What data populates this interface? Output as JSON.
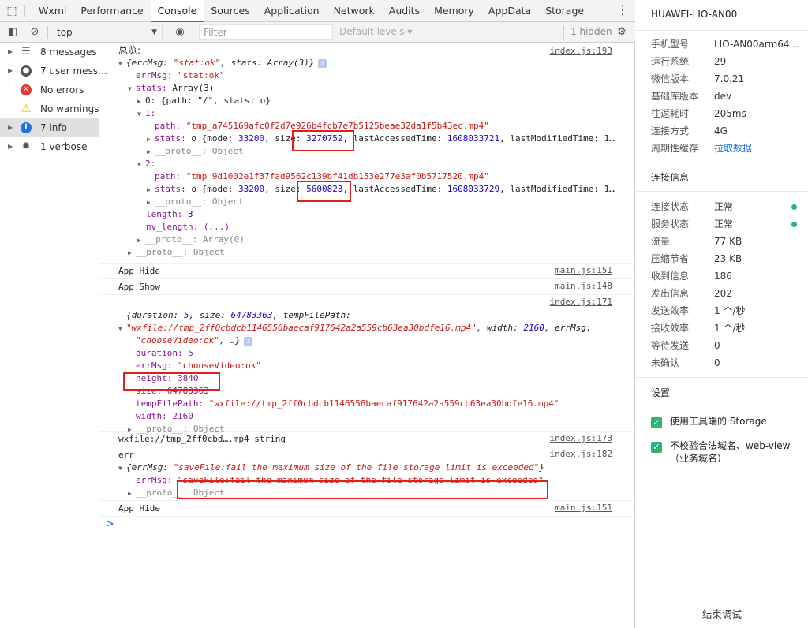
{
  "tabs": [
    "Wxml",
    "Performance",
    "Console",
    "Sources",
    "Application",
    "Network",
    "Audits",
    "Memory",
    "AppData",
    "Storage"
  ],
  "active_tab": "Console",
  "toolbar": {
    "context": "top",
    "filter_placeholder": "Filter",
    "levels": "Default levels ▾",
    "hidden": "1 hidden"
  },
  "sidebar": {
    "items": [
      {
        "label": "8 messages",
        "icon": "list-icon"
      },
      {
        "label": "7 user mess…",
        "icon": "user-icon"
      },
      {
        "label": "No errors",
        "icon": "error-icon"
      },
      {
        "label": "No warnings",
        "icon": "warning-icon"
      },
      {
        "label": "7 info",
        "icon": "info-icon"
      },
      {
        "label": "1 verbose",
        "icon": "bug-icon"
      }
    ]
  },
  "console": {
    "m1": {
      "label": "总览:",
      "src": "index.js:193",
      "summary_a": "{errMsg: ",
      "summary_b": "\"stat:ok\"",
      "summary_c": ", stats: Array(3)}",
      "errMsg_key": "errMsg: ",
      "errMsg_val": "\"stat:ok\"",
      "stats_key": "stats: ",
      "stats_val": "Array(3)",
      "item0": "0: {path: \"/\", stats: o}",
      "idx1": "1:",
      "path1_key": "path: ",
      "path1_val": "\"tmp_a745169afc0f2d7e926b4fcb7e7b5125beae32da1f5b43ec.mp4\"",
      "stats1_a": "stats: ",
      "stats1_b": "o {mode: ",
      "stats1_mode": "33200",
      "stats1_c": ", size: ",
      "stats1_size": "3270752",
      "stats1_d": ", lastAccessedTime: ",
      "stats1_lat": "1608033721",
      "stats1_e": ", lastModifiedTime: 1…",
      "proto1": "__proto__: Object",
      "idx2": "2:",
      "path2_val": "\"tmp_9d1002e1f37fad9562c139bf41db153e277e3af0b5717520.mp4\"",
      "stats2_mode": "33200",
      "stats2_size": "5600823",
      "stats2_lat": "1608033729",
      "proto2": "__proto__: Object",
      "length_key": "length: ",
      "length_val": "3",
      "nvlen": "nv_length: (...)",
      "proto_arr": "__proto__: Array(0)",
      "proto_obj": "__proto__: Object"
    },
    "m2": {
      "text": "App Hide",
      "src": "main.js:151"
    },
    "m3": {
      "text": "App Show",
      "src": "main.js:148"
    },
    "m4": {
      "src": "index.js:171",
      "head_a": "{duration: ",
      "head_dur": "5",
      "head_b": ", size: ",
      "head_size": "64783363",
      "head_c": ", tempFilePath:",
      "head2_path": "\"wxfile://tmp_2ff0cbdcb1146556baecaf917642a2a559cb63ea30bdfe16.mp4\"",
      "head2_b": ", width: ",
      "head2_w": "2160",
      "head2_c": ", errMsg:",
      "head3_msg": "\"chooseVideo:ok\"",
      "head3_b": ", …}",
      "duration": "duration: 5",
      "errMsg_key": "errMsg: ",
      "errMsg_val": "\"chooseVideo:ok\"",
      "height": "height: 3840",
      "size": "size: 64783363",
      "tfp_key": "tempFilePath: ",
      "tfp_val": "\"wxfile://tmp_2ff0cbdcb1146556baecaf917642a2a559cb63ea30bdfe16.mp4\"",
      "width": "width: 2160",
      "proto": "__proto__: Object"
    },
    "m5": {
      "link": "wxfile://tmp_2ff0cbd….mp4",
      "type": " string",
      "src": "index.js:173"
    },
    "m6": {
      "label": "err",
      "src": "index.js:182",
      "summary_a": "{errMsg: ",
      "summary_b": "\"saveFile:fail the maximum size of the file storage limit is exceeded\"",
      "summary_c": "}",
      "errMsg_key": "errMsg: ",
      "errMsg_val": "\"saveFile:fail the maximum size of the file storage limit is exceeded\"",
      "proto": "__proto__: Object"
    },
    "m7": {
      "text": "App Hide",
      "src": "main.js:151"
    },
    "prompt": ">"
  },
  "panel": {
    "device": "HUAWEI-LIO-AN00",
    "info": [
      {
        "label": "手机型号",
        "value": "LIO-AN00arm64…"
      },
      {
        "label": "运行系统",
        "value": "29"
      },
      {
        "label": "微信版本",
        "value": "7.0.21"
      },
      {
        "label": "基础库版本",
        "value": "dev"
      },
      {
        "label": "往返耗时",
        "value": "205ms"
      },
      {
        "label": "连接方式",
        "value": "4G"
      },
      {
        "label": "周期性缓存",
        "value": "拉取数据"
      }
    ],
    "conn_title": "连接信息",
    "conn": [
      {
        "label": "连接状态",
        "value": "正常"
      },
      {
        "label": "服务状态",
        "value": "正常"
      },
      {
        "label": "流量",
        "value": "77 KB"
      },
      {
        "label": "压缩节省",
        "value": "23 KB"
      },
      {
        "label": "收到信息",
        "value": "186"
      },
      {
        "label": "发出信息",
        "value": "202"
      },
      {
        "label": "发送效率",
        "value": "1 个/秒"
      },
      {
        "label": "接收效率",
        "value": "1 个/秒"
      },
      {
        "label": "等待发送",
        "value": "0"
      },
      {
        "label": "未确认",
        "value": "0"
      }
    ],
    "settings_title": "设置",
    "settings": [
      {
        "label": "使用工具端的 Storage",
        "checked": true
      },
      {
        "label": "不校验合法域名、web-view（业务域名）",
        "checked": true
      }
    ],
    "end_button": "结束调试",
    "status_color": "#2bb673"
  }
}
